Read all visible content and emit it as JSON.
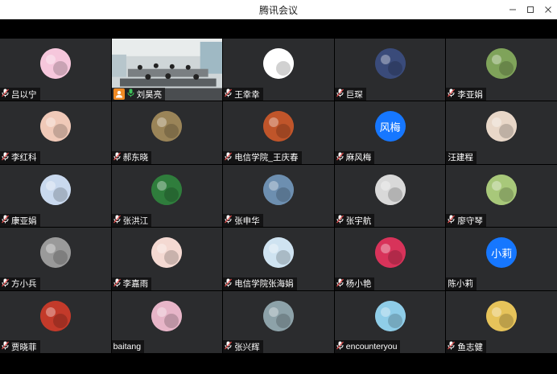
{
  "window": {
    "title": "腾讯会议",
    "minimize_icon": "minimize-icon",
    "maximize_icon": "maximize-icon",
    "close_icon": "close-icon"
  },
  "participants": [
    {
      "name": "吕以宁",
      "mic": "muted",
      "avatar": "anime-girl",
      "avatar_color": "#f6c7dc"
    },
    {
      "name": "刘昊亮",
      "mic": "active",
      "video": "classroom",
      "host": true
    },
    {
      "name": "王幸幸",
      "mic": "muted",
      "avatar": "cartoon-face",
      "avatar_color": "#ffffff"
    },
    {
      "name": "巨琛",
      "mic": "muted",
      "avatar": "sunset",
      "avatar_color": "#3a4b7a"
    },
    {
      "name": "李亚娟",
      "mic": "muted",
      "avatar": "flowers",
      "avatar_color": "#7fa35a"
    },
    {
      "name": "李红科",
      "mic": "muted",
      "avatar": "baby",
      "avatar_color": "#f0c9b8"
    },
    {
      "name": "郝东晓",
      "mic": "muted",
      "avatar": "tree",
      "avatar_color": "#9a8458"
    },
    {
      "name": "电信学院_王庆春",
      "mic": "muted",
      "avatar": "autumn",
      "avatar_color": "#c0552a"
    },
    {
      "name": "麻风梅",
      "mic": "muted",
      "avatar_text": "风梅",
      "avatar_color": "#1677ff"
    },
    {
      "name": "汪建程",
      "mic": "none",
      "avatar": "sunglasses",
      "avatar_color": "#e8d7c8"
    },
    {
      "name": "康亚娟",
      "mic": "muted",
      "avatar": "snow",
      "avatar_color": "#c9d9ee"
    },
    {
      "name": "张洪江",
      "mic": "muted",
      "avatar": "green-light",
      "avatar_color": "#2f7d3c"
    },
    {
      "name": "张申华",
      "mic": "muted",
      "avatar": "mountain",
      "avatar_color": "#6d8fb0"
    },
    {
      "name": "张宇航",
      "mic": "muted",
      "avatar": "flag",
      "avatar_color": "#d9d9d9"
    },
    {
      "name": "廖守琴",
      "mic": "muted",
      "avatar": "child",
      "avatar_color": "#a8c87a"
    },
    {
      "name": "方小兵",
      "mic": "muted",
      "avatar": "group",
      "avatar_color": "#9a9a9a"
    },
    {
      "name": "李嘉雨",
      "mic": "muted",
      "avatar": "mermaid",
      "avatar_color": "#f4d9d2"
    },
    {
      "name": "电信学院张海娟",
      "mic": "muted",
      "avatar": "girl-drawing",
      "avatar_color": "#cfe3f1"
    },
    {
      "name": "杨小艳",
      "mic": "muted",
      "avatar": "rose",
      "avatar_color": "#d8335a"
    },
    {
      "name": "陈小莉",
      "mic": "none",
      "avatar_text": "小莉",
      "avatar_color": "#1677ff"
    },
    {
      "name": "贾晓菲",
      "mic": "muted",
      "avatar": "mickey",
      "avatar_color": "#c33a2a"
    },
    {
      "name": "baitang",
      "mic": "none",
      "avatar": "magnolia",
      "avatar_color": "#e7b5c8"
    },
    {
      "name": "张兴辉",
      "mic": "muted",
      "avatar": "lake",
      "avatar_color": "#8da2a9"
    },
    {
      "name": "encounteryou",
      "mic": "muted",
      "avatar": "cartoon-kid",
      "avatar_color": "#8fcde8"
    },
    {
      "name": "鱼志健",
      "mic": "muted",
      "avatar": "smile-ball",
      "avatar_color": "#e6c35a"
    }
  ]
}
